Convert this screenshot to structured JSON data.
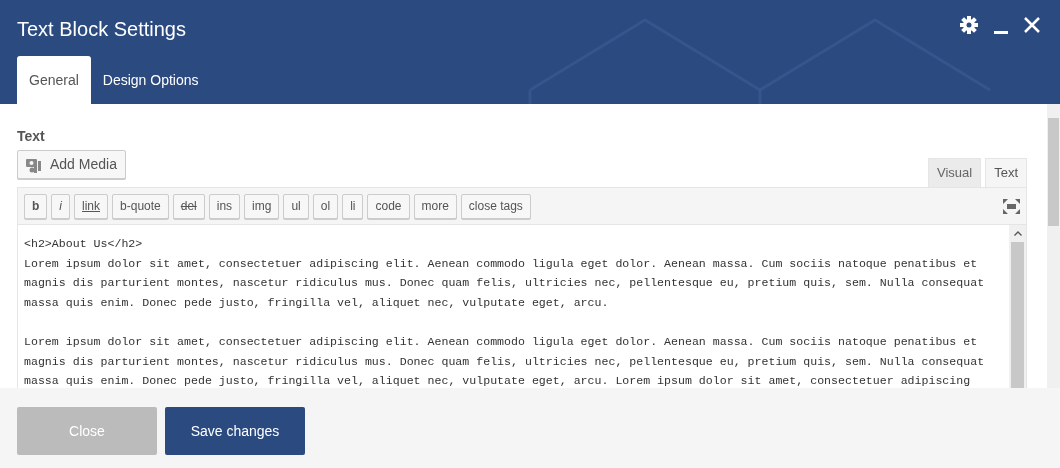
{
  "window": {
    "title": "Text Block Settings"
  },
  "tabs": [
    {
      "label": "General",
      "selected": true
    },
    {
      "label": "Design Options",
      "selected": false
    }
  ],
  "field": {
    "label": "Text",
    "add_media": "Add Media"
  },
  "editor_tabs": [
    {
      "label": "Visual",
      "selected": false
    },
    {
      "label": "Text",
      "selected": true
    }
  ],
  "quicktags": [
    {
      "label": "b",
      "kind": "bold"
    },
    {
      "label": "i",
      "kind": "italic"
    },
    {
      "label": "link",
      "kind": "underline"
    },
    {
      "label": "b-quote",
      "kind": "plain"
    },
    {
      "label": "del",
      "kind": "strike"
    },
    {
      "label": "ins",
      "kind": "plain"
    },
    {
      "label": "img",
      "kind": "plain"
    },
    {
      "label": "ul",
      "kind": "plain"
    },
    {
      "label": "ol",
      "kind": "plain"
    },
    {
      "label": "li",
      "kind": "plain"
    },
    {
      "label": "code",
      "kind": "plain"
    },
    {
      "label": "more",
      "kind": "plain"
    },
    {
      "label": "close tags",
      "kind": "plain"
    }
  ],
  "editor": {
    "paragraphs": [
      [
        "<h2>About Us</h2>",
        "Lorem ipsum dolor sit amet, consectetuer adipiscing elit. Aenean commodo ligula eget dolor. Aenean massa. Cum sociis natoque penatibus et",
        "magnis dis parturient montes, nascetur ridiculus mus. Donec quam felis, ultricies nec, pellentesque eu, pretium quis, sem. Nulla consequat",
        "massa quis enim. Donec pede justo, fringilla vel, aliquet nec, vulputate eget, arcu."
      ],
      [
        "Lorem ipsum dolor sit amet, consectetuer adipiscing elit. Aenean commodo ligula eget dolor. Aenean massa. Cum sociis natoque penatibus et",
        "magnis dis parturient montes, nascetur ridiculus mus. Donec quam felis, ultricies nec, pellentesque eu, pretium quis, sem. Nulla consequat",
        "massa quis enim. Donec pede justo, fringilla vel, aliquet nec, vulputate eget, arcu. Lorem ipsum dolor sit amet, consectetuer adipiscing"
      ]
    ]
  },
  "footer": {
    "buttons": [
      {
        "label": "Close",
        "kind": "secondary"
      },
      {
        "label": "Save changes",
        "kind": "primary"
      }
    ]
  }
}
